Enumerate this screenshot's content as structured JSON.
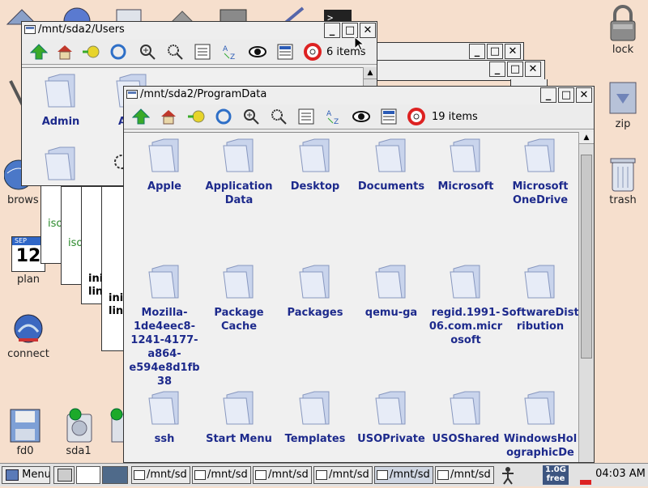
{
  "desktop": {
    "lock_label": "lock",
    "zip_label": "zip",
    "trash_label": "trash",
    "browse_label": "brows",
    "plan_label": "plan",
    "plan_day": "12",
    "plan_month": "SEP",
    "connect_label": "connect",
    "fd0_label": "fd0",
    "sda1_label": "sda1"
  },
  "bg_windows": {
    "iso1": "iso",
    "iso2": "iso",
    "ini1": "ini",
    "lin1": "lin",
    "ini2": "ini",
    "lin2": "lin"
  },
  "users_window": {
    "title": "/mnt/sda2/Users",
    "item_count": "6 items",
    "folders": [
      "Admin",
      "All U"
    ]
  },
  "pd_window": {
    "title": "/mnt/sda2/ProgramData",
    "item_count": "19 items",
    "folders": [
      "Apple",
      "Application Data",
      "Desktop",
      "Documents",
      "Microsoft",
      "Microsoft OneDrive",
      "Mozilla-1de4eec8-1241-4177-a864-e594e8d1fb38",
      "Package Cache",
      "Packages",
      "qemu-ga",
      "regid.1991-06.com.microsoft",
      "SoftwareDistribution",
      "ssh",
      "Start Menu",
      "Templates",
      "USOPrivate",
      "USOShared",
      "WindowsHolographicDe"
    ]
  },
  "taskbar": {
    "menu_label": "Menu",
    "tasks": [
      "/mnt/sd",
      "/mnt/sd",
      "/mnt/sd",
      "/mnt/sd",
      "/mnt/sd",
      "/mnt/sd"
    ],
    "mem_top": "1.0G",
    "mem_bottom": "free",
    "clock": "04:03 AM"
  },
  "colors": {
    "desktop_bg": "#f6dfcd",
    "folder_label": "#1d2a8c"
  }
}
